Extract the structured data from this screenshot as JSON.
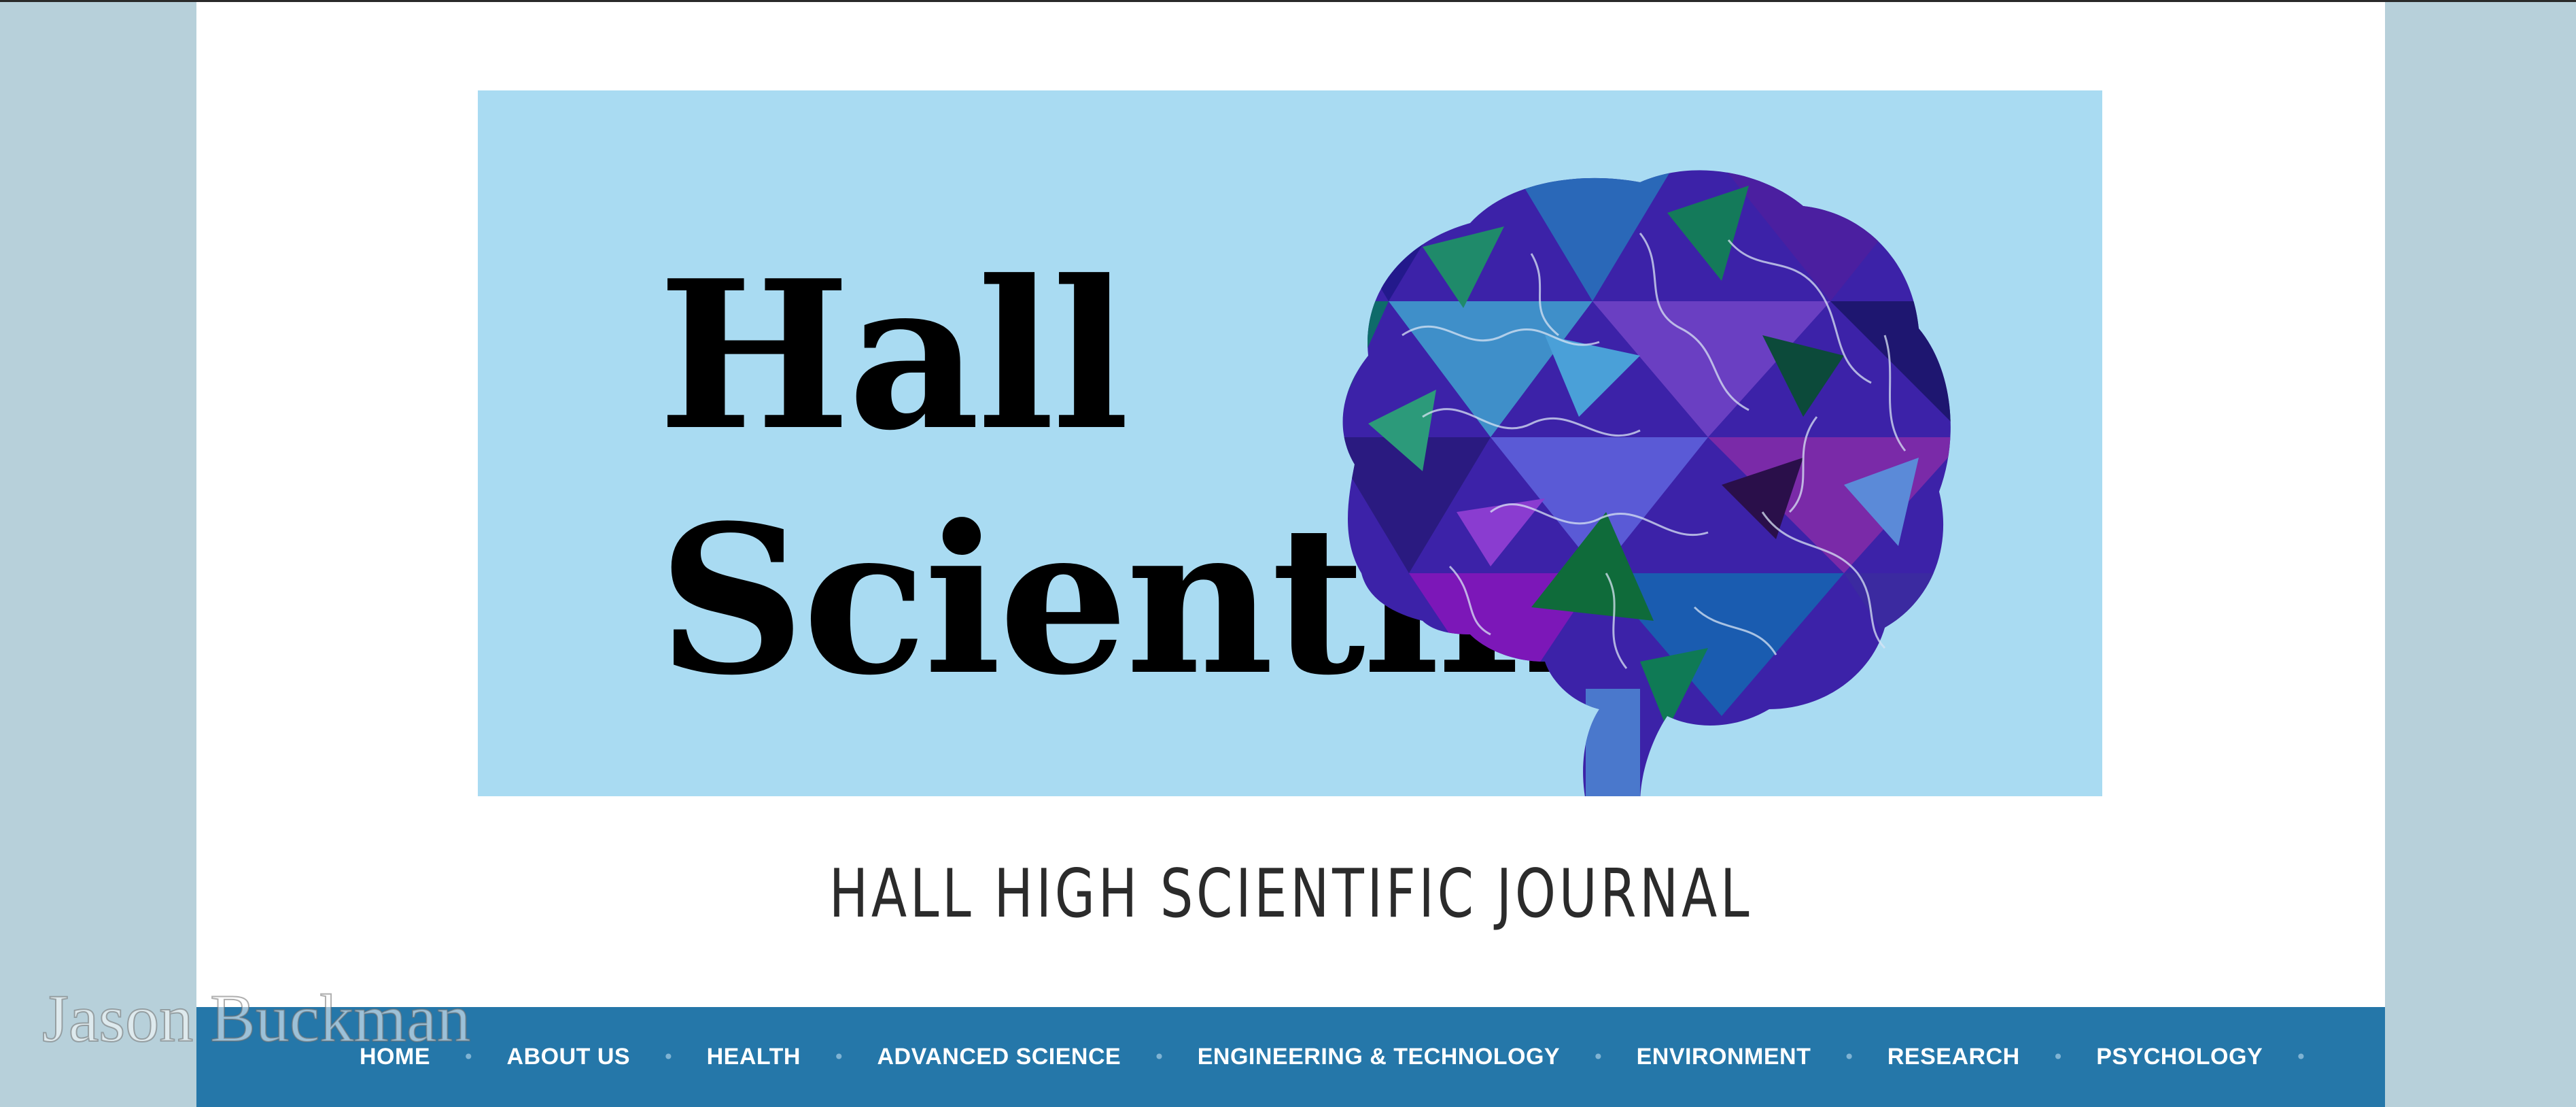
{
  "site": {
    "logo_line1": "Hall",
    "logo_line2": "Scientific",
    "tagline": "HALL HIGH SCIENTIFIC JOURNAL"
  },
  "nav": {
    "items": [
      {
        "label": "HOME"
      },
      {
        "label": "ABOUT US"
      },
      {
        "label": "HEALTH"
      },
      {
        "label": "ADVANCED SCIENCE"
      },
      {
        "label": "ENGINEERING & TECHNOLOGY"
      },
      {
        "label": "ENVIRONMENT"
      },
      {
        "label": "RESEARCH"
      },
      {
        "label": "PSYCHOLOGY"
      }
    ],
    "separator": "•"
  },
  "watermark": {
    "text": "Jason Buckman"
  },
  "colors": {
    "background": "#b7d0da",
    "banner": "#a9dbf2",
    "nav": "#2577a9",
    "nav_text": "#ffffff",
    "tagline": "#2b2b2b"
  },
  "icons": {
    "brain": "brain-illustration"
  }
}
